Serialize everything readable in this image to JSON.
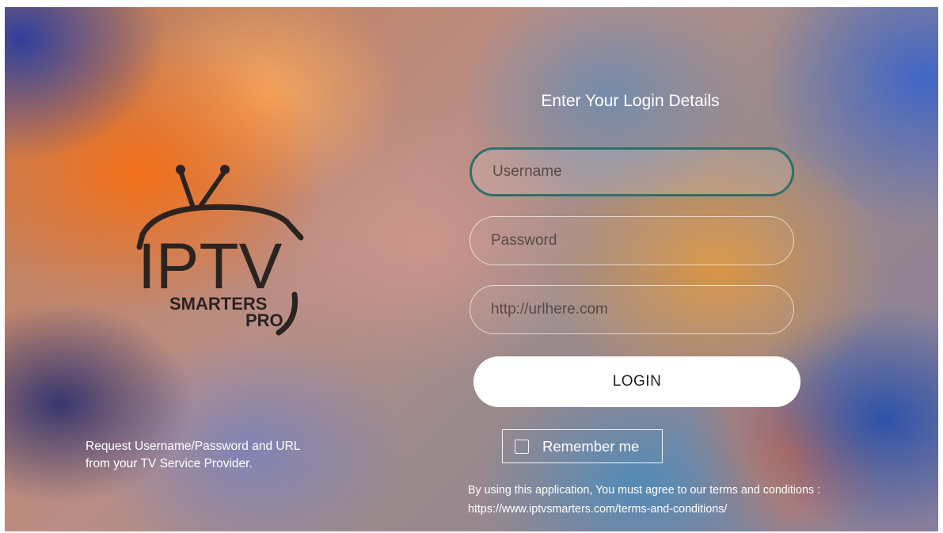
{
  "login": {
    "title": "Enter Your Login Details",
    "username_placeholder": "Username",
    "password_placeholder": "Password",
    "url_placeholder": "http://urlhere.com",
    "login_button": "LOGIN",
    "remember_label": "Remember me",
    "remember_checked": false,
    "terms_text": "By using this application,  You must agree to our terms and conditions :",
    "terms_url": "https://www.iptvsmarters.com/terms-and-conditions/"
  },
  "branding": {
    "logo_main": "IPTV",
    "logo_sub": "SMARTERS",
    "logo_tag": "PRO",
    "request_line1": "Request Username/Password and URL",
    "request_line2": "from your TV Service Provider."
  },
  "colors": {
    "focus_border": "#2f6f6a",
    "button_bg": "#ffffff",
    "logo_ink": "#2b2320"
  }
}
